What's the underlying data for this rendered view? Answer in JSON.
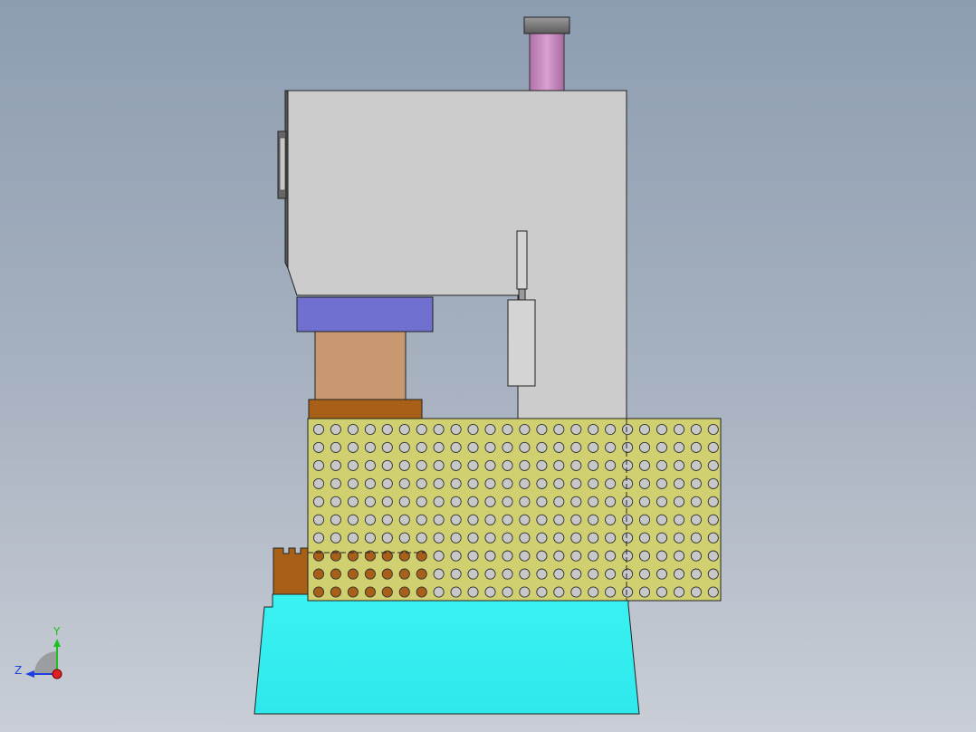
{
  "viewport": {
    "background_top": "#8d9db0",
    "background_bottom": "#c9ced6"
  },
  "model": {
    "cylinder_color": "#c890c0",
    "frame_color": "#cccccc",
    "ram_plate_color": "#7070d0",
    "punch_color": "#c89870",
    "die_color": "#a86018",
    "guard_color": "#d0d070",
    "base_color": "#33f0f0"
  },
  "triad": {
    "y_label": "Y",
    "z_label": "Z",
    "x_axis_color": "#e02020",
    "y_axis_color": "#20c020",
    "z_axis_color": "#2040e0"
  }
}
